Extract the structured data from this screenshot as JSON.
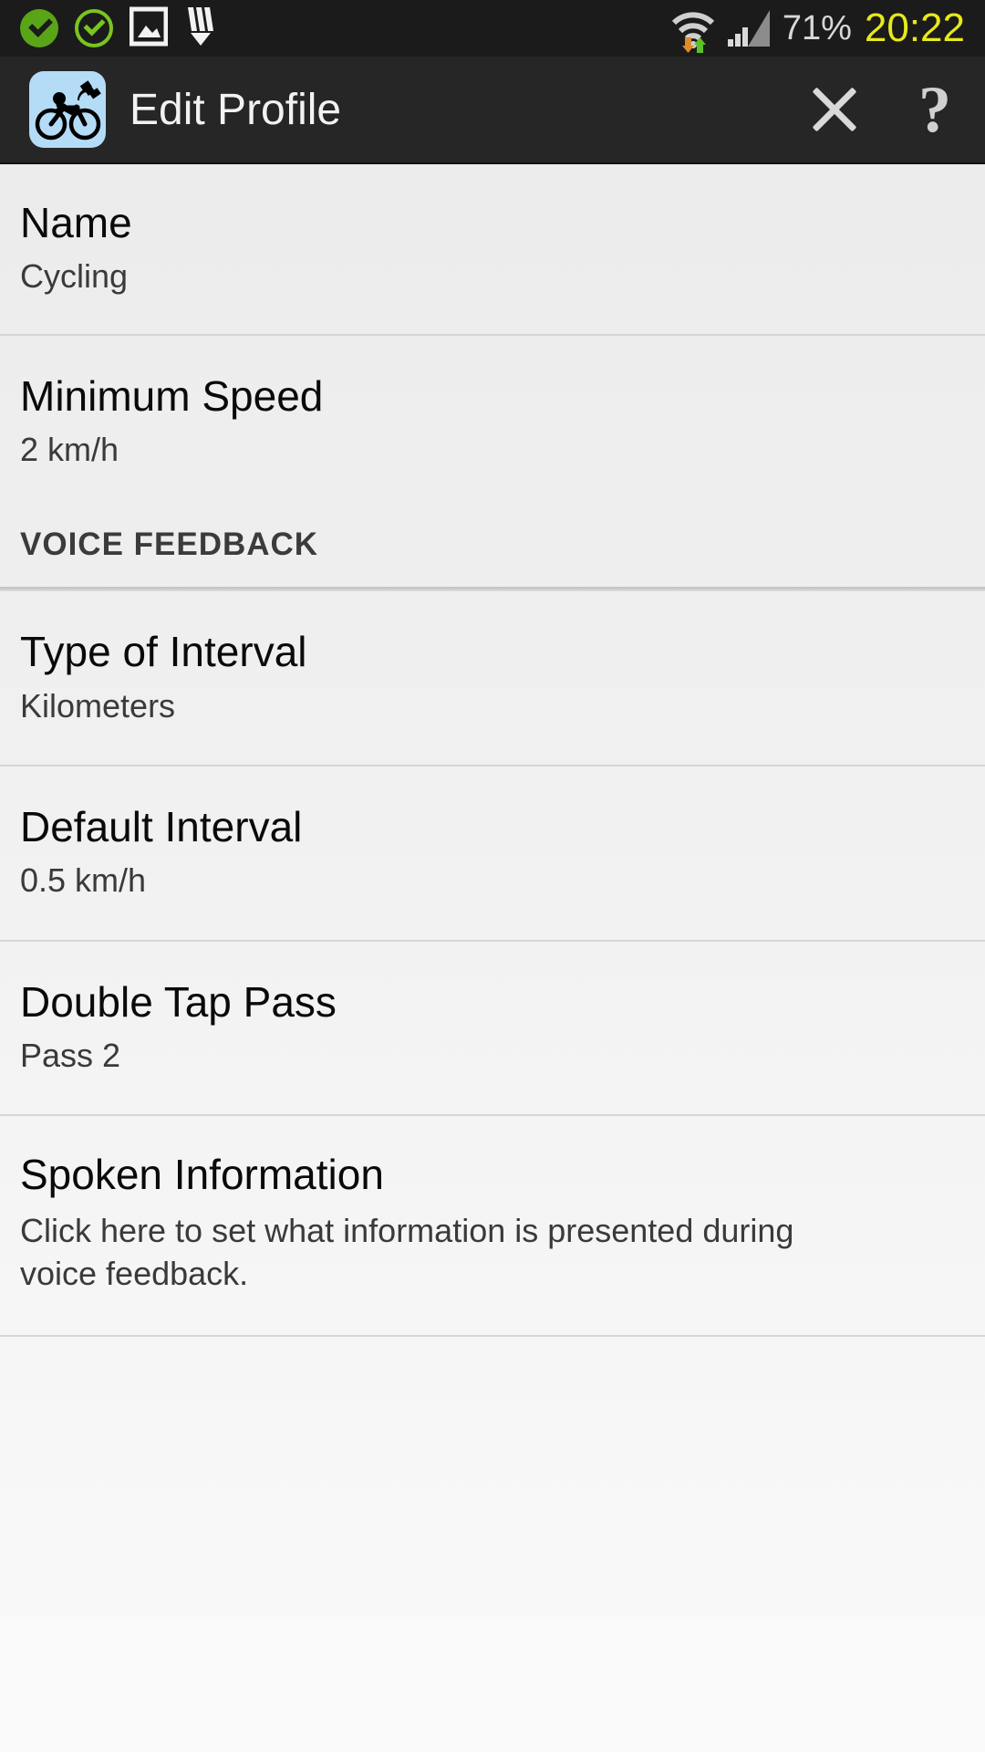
{
  "status_bar": {
    "icons": [
      {
        "name": "check-filled-icon",
        "label": "sync complete"
      },
      {
        "name": "check-outline-icon",
        "label": "sync complete outline"
      },
      {
        "name": "image-icon",
        "label": "screenshot captured"
      },
      {
        "name": "pencil-download-icon",
        "label": "download"
      }
    ],
    "wifi_icon": "wifi-icon",
    "wifi_activity_down": "data-down-arrow-icon",
    "wifi_activity_up": "data-up-arrow-icon",
    "signal_icon": "cellular-signal-icon",
    "battery": "71%",
    "clock": "20:22",
    "clock_color": "#e8e81c",
    "background": "#1b1b1b"
  },
  "action_bar": {
    "app_icon": "cycling-gps-app-icon",
    "title": "Edit Profile",
    "close_label": "close-icon",
    "help_label": "?",
    "background": "#262626"
  },
  "list": [
    {
      "key": "name",
      "type": "item",
      "title": "Name",
      "subtitle": "Cycling"
    },
    {
      "key": "minimum-speed",
      "type": "item",
      "title": "Minimum Speed",
      "subtitle": "2 km/h"
    },
    {
      "key": "voice-feedback",
      "type": "section",
      "title": "VOICE FEEDBACK"
    },
    {
      "key": "type-of-interval",
      "type": "item",
      "title": "Type of Interval",
      "subtitle": "Kilometers"
    },
    {
      "key": "default-interval",
      "type": "item",
      "title": "Default Interval",
      "subtitle": "0.5 km/h"
    },
    {
      "key": "double-tap-pass",
      "type": "item",
      "title": "Double Tap Pass",
      "subtitle": "Pass 2"
    },
    {
      "key": "spoken-information",
      "type": "item",
      "title": "Spoken Information",
      "subtitle": "Click here to set what information is presented during voice feedback."
    }
  ],
  "theme": {
    "accent_blue": "#b4dcf7",
    "list_background": "#ececec",
    "divider": "#d6d6d6",
    "title_color": "#0a0a0a",
    "subtitle_color": "#3a3a3a",
    "status_green": "#5aa517"
  }
}
